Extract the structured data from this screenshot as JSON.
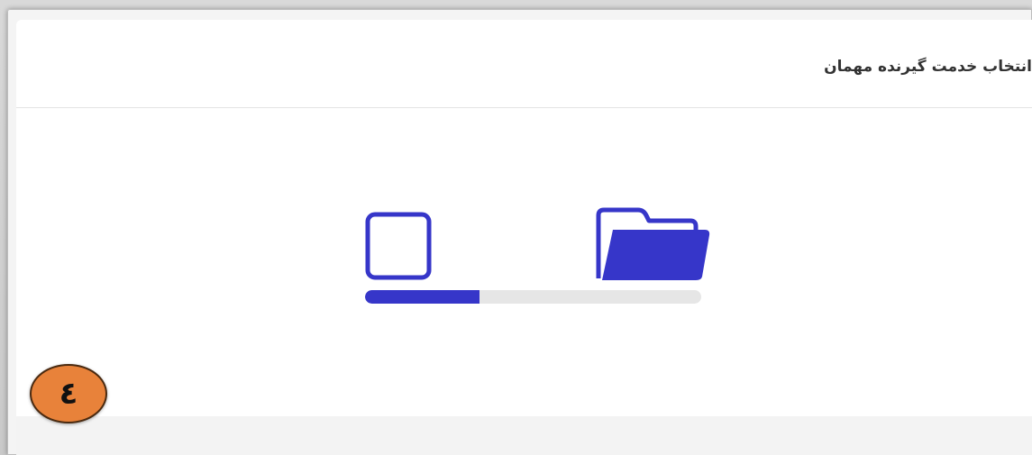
{
  "panel": {
    "title": "انتخاب خدمت گیرنده مهمان"
  },
  "loader": {
    "source_icon": "document-icon",
    "target_icon": "folder-icon",
    "progress_fraction": 0.34,
    "accent_color": "#3636c9",
    "track_color": "#e6e6e6"
  },
  "badge": {
    "label": "٤",
    "color": "#e8823a"
  }
}
